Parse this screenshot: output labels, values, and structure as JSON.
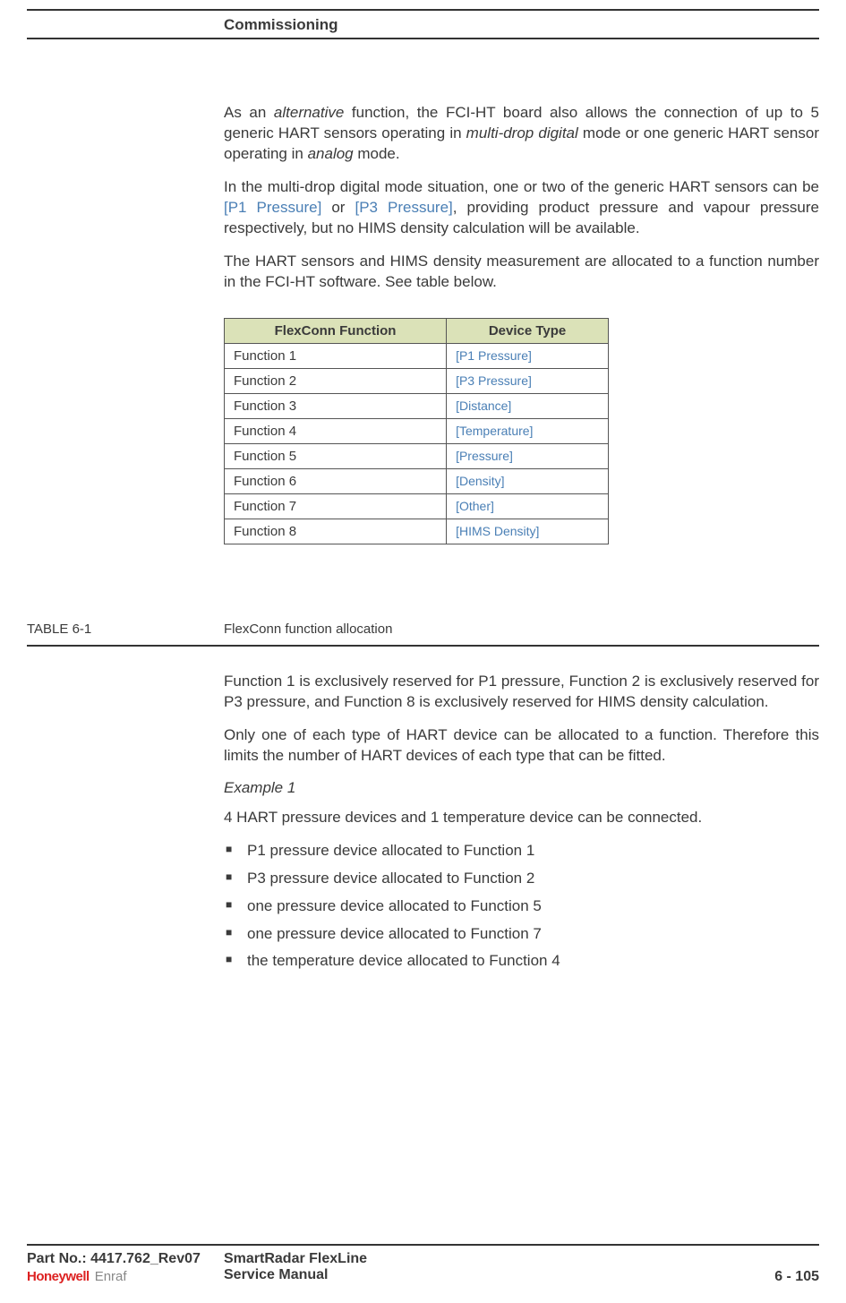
{
  "header": {
    "title": "Commissioning"
  },
  "body": {
    "p1a": "As an ",
    "p1b": "alternative",
    "p1c": " function, the FCI-HT board also allows the connection of up to 5 generic HART sensors operating in ",
    "p1d": "multi-drop digital",
    "p1e": " mode or one generic HART sensor operating in ",
    "p1f": "analog",
    "p1g": " mode.",
    "p2a": "In the multi-drop digital mode situation, one or two of the generic HART sensors can be ",
    "p2b": "[P1 Pressure]",
    "p2c": " or ",
    "p2d": "[P3 Pressure]",
    "p2e": ", providing product pressure and vapour pressure respectively, but no HIMS density calculation will be available.",
    "p3": "The HART sensors and HIMS density measurement are allocated to a function number in the FCI-HT software. See table below.",
    "p4": "Function 1 is exclusively reserved for P1 pressure, Function 2 is exclusively reserved for P3 pressure, and Function 8 is exclusively reserved for HIMS density calculation.",
    "p5": "Only one of each type of HART device can be allocated to a function. Therefore this limits the number of HART devices of each type that can be fitted.",
    "example_heading": "Example 1",
    "p6": "4 HART pressure devices and 1 temperature device can be connected.",
    "bullets": [
      "P1 pressure device allocated to Function 1",
      "P3 pressure device allocated to Function 2",
      "one pressure device allocated to Function 5",
      "one pressure device allocated to Function 7",
      "the temperature device allocated to Function 4"
    ]
  },
  "table": {
    "caption_label": "TABLE  6-1",
    "caption_text": "FlexConn function allocation",
    "headers": {
      "col1": "FlexConn Function",
      "col2": "Device Type"
    },
    "rows": [
      {
        "fn": "Function 1",
        "dev": "[P1 Pressure]"
      },
      {
        "fn": "Function 2",
        "dev": "[P3 Pressure]"
      },
      {
        "fn": "Function 3",
        "dev": "[Distance]"
      },
      {
        "fn": "Function 4",
        "dev": "[Temperature]"
      },
      {
        "fn": "Function 5",
        "dev": "[Pressure]"
      },
      {
        "fn": "Function 6",
        "dev": "[Density]"
      },
      {
        "fn": "Function 7",
        "dev": "[Other]"
      },
      {
        "fn": "Function 8",
        "dev": "[HIMS Density]"
      }
    ]
  },
  "footer": {
    "part_no": "Part No.: 4417.762_Rev07",
    "doc_title": "SmartRadar FlexLine",
    "doc_sub": "Service Manual",
    "page_no": "6 - 105",
    "logo_main": "Honeywell",
    "logo_sub": "Enraf"
  }
}
